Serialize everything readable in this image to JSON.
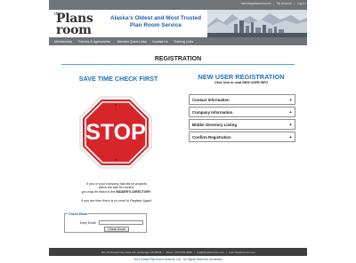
{
  "top_links": {
    "site": "www.theplansroom.com",
    "account": "My Account",
    "login": "Log In"
  },
  "logo": {
    "the": "the",
    "plans": "Plans",
    "room": "room"
  },
  "tagline": {
    "line1": "Alaska's Oldest and Most Trusted",
    "line2": "Plan Room Service"
  },
  "nav": {
    "items": [
      "Membership",
      "Policies & Agreements",
      "Member Quick Links",
      "Contact Us",
      "Training Links"
    ]
  },
  "registration": {
    "title": "REGISTRATION"
  },
  "left": {
    "title": "SAVE TIME CHECK FIRST",
    "stop_text": "STOP",
    "info_line1": "If you or your company has bid on projects",
    "info_line2": "within the last 36 months,",
    "info_line3": "you may be listed in the",
    "info_emph": "BIDDER'S DIRECTORY",
    "info_line4": "If you are then there is no need to Register Again!"
  },
  "check_email": {
    "legend": "Check Email",
    "label": "Entry Email:",
    "value": "",
    "button": "Check Email"
  },
  "right": {
    "title": "NEW USER REGISTRATION",
    "subtitle": "Click here to read NEW USER INFO",
    "sections": [
      {
        "label": "Contact Information",
        "icon": "+"
      },
      {
        "label": "Company Information",
        "icon": "+"
      },
      {
        "label": "Bidder Directory Listing",
        "icon": "+"
      },
      {
        "label": "Confirm Registration",
        "icon": "+"
      }
    ]
  },
  "footer": {
    "address": " 501 Old Seward Hwy Suite 101, Anchorage, AK 99518   |   Phone: (907) 563-3308   |   mail@theplansroom.com   |   www.theplansroom.com",
    "copyright": "2022 Virtual Plan Room Network, Ltd. - All Rights Reserved Worldwide"
  },
  "colors": {
    "accent": "#1f72b8",
    "nav_bg": "#6e7478",
    "stop_red": "#d7262a",
    "rule": "#4aa8c8"
  }
}
